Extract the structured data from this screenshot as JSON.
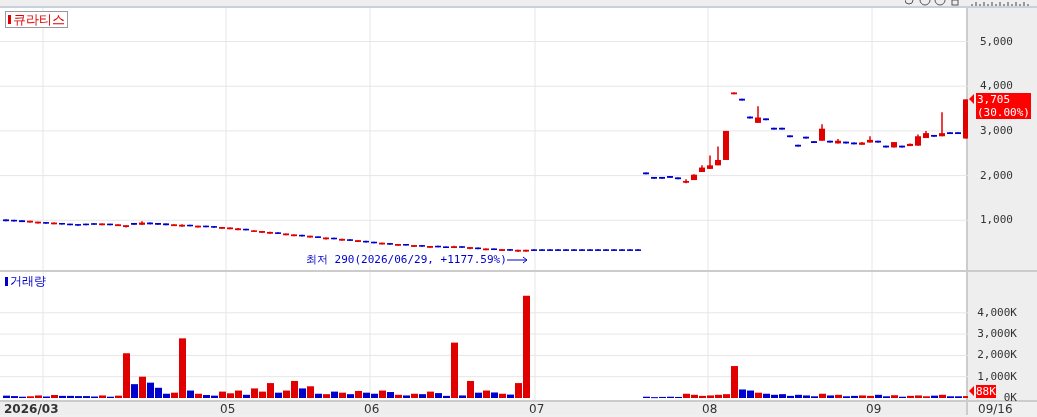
{
  "price_panel": {
    "title": "큐라티스",
    "current_price": "3,705",
    "current_change": "(30.00%)",
    "low_note": "최저 290(2026/06/29, +1177.59%)",
    "chart_data": {
      "type": "candlestick",
      "grid": true,
      "ylim": [
        -112,
        5750
      ],
      "yticks": [
        {
          "value": 5000,
          "label": "5,000"
        },
        {
          "value": 4000,
          "label": "4,000"
        },
        {
          "value": 3000,
          "label": "3,000"
        },
        {
          "value": 2000,
          "label": "2,000"
        },
        {
          "value": 1000,
          "label": "1,000"
        }
      ],
      "ohlc": [
        [
          1020,
          1020,
          980,
          980
        ],
        [
          1010,
          1010,
          975,
          975
        ],
        [
          1000,
          1000,
          960,
          960
        ],
        [
          950,
          990,
          950,
          990
        ],
        [
          930,
          970,
          930,
          970
        ],
        [
          960,
          960,
          925,
          925
        ],
        [
          910,
          950,
          910,
          950
        ],
        [
          940,
          940,
          905,
          905
        ],
        [
          925,
          925,
          890,
          890
        ],
        [
          915,
          915,
          880,
          880
        ],
        [
          925,
          925,
          890,
          890
        ],
        [
          935,
          935,
          900,
          900
        ],
        [
          890,
          930,
          890,
          930
        ],
        [
          925,
          925,
          890,
          890
        ],
        [
          870,
          910,
          870,
          910
        ],
        [
          850,
          890,
          840,
          890
        ],
        [
          940,
          940,
          900,
          900
        ],
        [
          900,
          980,
          895,
          950
        ],
        [
          950,
          950,
          910,
          910
        ],
        [
          940,
          940,
          900,
          900
        ],
        [
          930,
          930,
          890,
          890
        ],
        [
          870,
          910,
          870,
          910
        ],
        [
          860,
          910,
          855,
          900
        ],
        [
          900,
          900,
          865,
          865
        ],
        [
          840,
          880,
          840,
          880
        ],
        [
          880,
          880,
          845,
          845
        ],
        [
          870,
          870,
          835,
          835
        ],
        [
          810,
          850,
          810,
          850
        ],
        [
          800,
          840,
          800,
          840
        ],
        [
          780,
          825,
          775,
          820
        ],
        [
          810,
          810,
          775,
          775
        ],
        [
          740,
          775,
          740,
          775
        ],
        [
          720,
          760,
          715,
          760
        ],
        [
          700,
          745,
          700,
          740
        ],
        [
          730,
          730,
          695,
          695
        ],
        [
          665,
          705,
          665,
          705
        ],
        [
          645,
          685,
          645,
          685
        ],
        [
          675,
          675,
          640,
          640
        ],
        [
          615,
          655,
          615,
          655
        ],
        [
          640,
          640,
          605,
          605
        ],
        [
          575,
          615,
          570,
          615
        ],
        [
          610,
          610,
          575,
          575
        ],
        [
          545,
          585,
          545,
          585
        ],
        [
          575,
          575,
          540,
          540
        ],
        [
          515,
          555,
          515,
          555
        ],
        [
          540,
          540,
          505,
          505
        ],
        [
          520,
          520,
          485,
          485
        ],
        [
          460,
          500,
          460,
          500
        ],
        [
          490,
          490,
          455,
          455
        ],
        [
          430,
          470,
          430,
          470
        ],
        [
          470,
          470,
          435,
          435
        ],
        [
          405,
          445,
          405,
          445
        ],
        [
          445,
          445,
          410,
          410
        ],
        [
          385,
          425,
          385,
          425
        ],
        [
          430,
          430,
          395,
          395
        ],
        [
          415,
          415,
          380,
          380
        ],
        [
          380,
          430,
          380,
          420
        ],
        [
          420,
          420,
          385,
          385
        ],
        [
          360,
          400,
          355,
          400
        ],
        [
          390,
          390,
          355,
          355
        ],
        [
          330,
          370,
          330,
          370
        ],
        [
          370,
          370,
          335,
          335
        ],
        [
          315,
          355,
          315,
          355
        ],
        [
          355,
          355,
          320,
          320
        ],
        [
          300,
          340,
          290,
          340
        ],
        [
          300,
          340,
          295,
          340
        ],
        [
          350,
          350,
          315,
          315
        ],
        [
          350,
          350,
          315,
          315
        ],
        [
          350,
          350,
          315,
          315
        ],
        [
          350,
          350,
          315,
          315
        ],
        [
          350,
          350,
          315,
          315
        ],
        [
          350,
          350,
          315,
          315
        ],
        [
          350,
          350,
          315,
          315
        ],
        [
          350,
          350,
          315,
          315
        ],
        [
          350,
          350,
          315,
          315
        ],
        [
          350,
          350,
          315,
          315
        ],
        [
          350,
          350,
          315,
          315
        ],
        [
          350,
          350,
          315,
          315
        ],
        [
          350,
          350,
          315,
          315
        ],
        [
          350,
          350,
          315,
          315
        ],
        [
          2070,
          2070,
          2030,
          2030
        ],
        [
          1970,
          1970,
          1930,
          1930
        ],
        [
          1970,
          1970,
          1930,
          1930
        ],
        [
          1990,
          1990,
          1950,
          1950
        ],
        [
          1960,
          1960,
          1920,
          1920
        ],
        [
          1840,
          1920,
          1830,
          1880
        ],
        [
          1900,
          2030,
          1900,
          2020
        ],
        [
          2080,
          2230,
          2080,
          2180
        ],
        [
          2150,
          2450,
          2150,
          2230
        ],
        [
          2230,
          2650,
          2230,
          2350
        ],
        [
          2350,
          3000,
          2350,
          3000
        ],
        [
          3820,
          3860,
          3820,
          3860
        ],
        [
          3720,
          3720,
          3680,
          3680
        ],
        [
          3320,
          3320,
          3280,
          3280
        ],
        [
          3180,
          3550,
          3180,
          3300
        ],
        [
          3280,
          3280,
          3240,
          3240
        ],
        [
          3070,
          3070,
          3030,
          3030
        ],
        [
          3070,
          3070,
          3030,
          3030
        ],
        [
          2900,
          2900,
          2860,
          2860
        ],
        [
          2690,
          2690,
          2650,
          2650
        ],
        [
          2870,
          2870,
          2830,
          2830
        ],
        [
          2770,
          2770,
          2730,
          2730
        ],
        [
          2780,
          3150,
          2780,
          3050
        ],
        [
          2780,
          2780,
          2740,
          2740
        ],
        [
          2720,
          2820,
          2720,
          2780
        ],
        [
          2760,
          2760,
          2720,
          2720
        ],
        [
          2740,
          2740,
          2700,
          2700
        ],
        [
          2690,
          2750,
          2690,
          2740
        ],
        [
          2740,
          2880,
          2740,
          2800
        ],
        [
          2780,
          2780,
          2740,
          2740
        ],
        [
          2670,
          2670,
          2630,
          2630
        ],
        [
          2630,
          2750,
          2630,
          2750
        ],
        [
          2670,
          2670,
          2630,
          2630
        ],
        [
          2660,
          2720,
          2660,
          2710
        ],
        [
          2670,
          2920,
          2670,
          2880
        ],
        [
          2840,
          3000,
          2840,
          2950
        ],
        [
          2910,
          2910,
          2870,
          2870
        ],
        [
          2880,
          3420,
          2880,
          2950
        ],
        [
          2970,
          2970,
          2930,
          2930
        ],
        [
          2970,
          2970,
          2930,
          2930
        ],
        [
          2830,
          3705,
          2830,
          3705
        ]
      ]
    }
  },
  "volume_panel": {
    "title": "거래량",
    "current_volume": "88K",
    "chart_data": {
      "type": "bar",
      "grid": true,
      "ylim": [
        0,
        5915
      ],
      "yticks": [
        {
          "value": 4000,
          "label": "4,000K"
        },
        {
          "value": 3000,
          "label": "3,000K"
        },
        {
          "value": 2000,
          "label": "2,000K"
        },
        {
          "value": 1000,
          "label": "1,000K"
        },
        {
          "value": 0,
          "label": "0K"
        }
      ],
      "series": [
        {
          "color": "#e00000",
          "values": [
            null,
            null,
            null,
            80,
            120,
            null,
            140,
            null,
            null,
            null,
            null,
            null,
            120,
            null,
            110,
            2100,
            null,
            1000,
            null,
            null,
            null,
            250,
            2800,
            null,
            200,
            null,
            null,
            300,
            220,
            350,
            null,
            450,
            300,
            700,
            null,
            350,
            800,
            null,
            550,
            null,
            180,
            null,
            250,
            null,
            330,
            null,
            null,
            350,
            null,
            150,
            null,
            200,
            null,
            300,
            null,
            null,
            2600,
            null,
            800,
            null,
            350,
            null,
            200,
            null,
            700,
            4800,
            null,
            null,
            null,
            null,
            null,
            null,
            null,
            null,
            null,
            null,
            null,
            null,
            null,
            null,
            null,
            null,
            null,
            null,
            null,
            200,
            150,
            100,
            120,
            150,
            180,
            1500,
            null,
            null,
            250,
            null,
            null,
            null,
            null,
            null,
            null,
            null,
            200,
            null,
            150,
            null,
            null,
            120,
            100,
            null,
            null,
            130,
            null,
            100,
            120,
            80,
            null,
            150,
            null,
            null,
            90
          ]
        },
        {
          "color": "#0000cc",
          "values": [
            110,
            90,
            60,
            null,
            null,
            70,
            null,
            100,
            100,
            90,
            90,
            70,
            null,
            60,
            null,
            null,
            650,
            null,
            720,
            480,
            200,
            null,
            null,
            350,
            null,
            140,
            110,
            null,
            null,
            null,
            150,
            null,
            null,
            null,
            250,
            null,
            null,
            450,
            null,
            200,
            null,
            300,
            null,
            180,
            null,
            250,
            200,
            null,
            280,
            null,
            120,
            null,
            180,
            null,
            230,
            100,
            null,
            120,
            null,
            250,
            null,
            260,
            null,
            160,
            null,
            null,
            null,
            null,
            null,
            null,
            null,
            null,
            null,
            null,
            null,
            null,
            null,
            null,
            null,
            null,
            60,
            40,
            50,
            60,
            50,
            null,
            null,
            null,
            null,
            null,
            null,
            null,
            400,
            350,
            null,
            200,
            150,
            180,
            100,
            150,
            120,
            80,
            null,
            120,
            null,
            80,
            100,
            null,
            null,
            150,
            80,
            null,
            60,
            null,
            null,
            null,
            110,
            null,
            80,
            80,
            null
          ]
        }
      ]
    }
  },
  "x_axis": {
    "labels": [
      "2026/03",
      "05",
      "06",
      "07",
      "08",
      "09"
    ],
    "last_date": "09/16"
  }
}
